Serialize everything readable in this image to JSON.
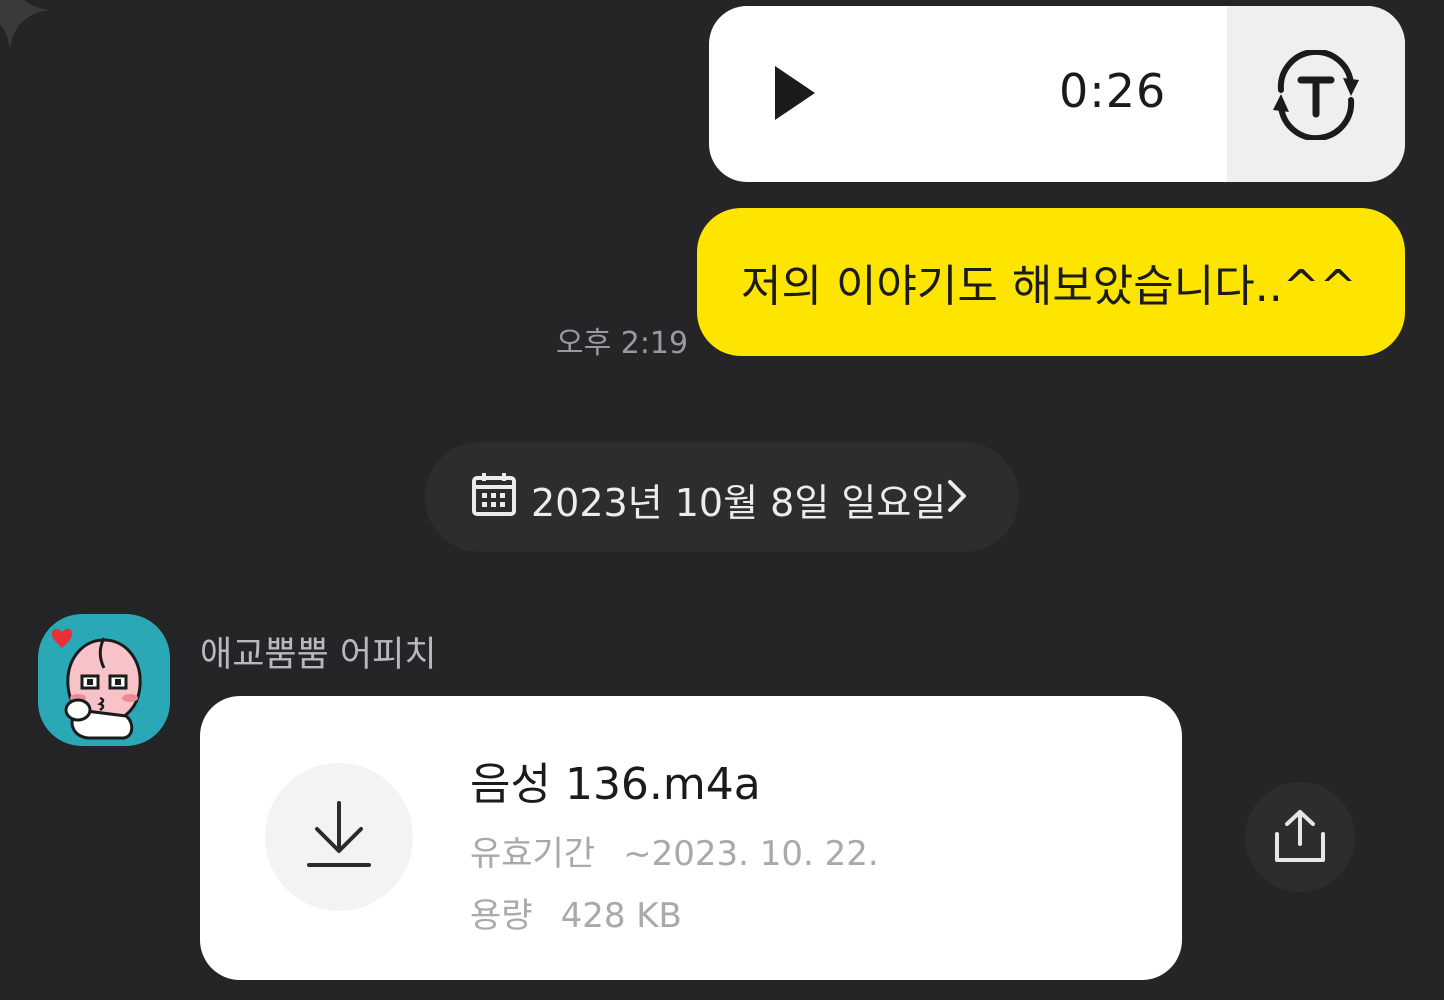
{
  "colors": {
    "background": "#252527",
    "my_bubble": "#fee500",
    "voice_bubble": "#ffffff",
    "transcribe_panel": "#efefef",
    "pill": "#2d2d30",
    "avatar_bg": "#2aa8b6"
  },
  "voice_message": {
    "play_icon": "play-icon",
    "duration": "0:26",
    "transcribe_icon": "speech-to-text-icon"
  },
  "text_message": {
    "text": "저의 이야기도 해보았습니다..^^",
    "time": "오후 2:19"
  },
  "date_divider": {
    "icon": "calendar-icon",
    "label": "2023년 10월 8일 일요일",
    "chevron_icon": "chevron-right-icon"
  },
  "incoming": {
    "sender": "애교뿜뿜 어피치",
    "avatar_icon": "apeach-avatar",
    "file": {
      "name": "음성 136.m4a",
      "expiry_label": "유효기간",
      "expiry_value": "~2023. 10. 22.",
      "size_label": "용량",
      "size_value": "428 KB",
      "download_icon": "download-icon"
    },
    "share_icon": "share-icon"
  }
}
